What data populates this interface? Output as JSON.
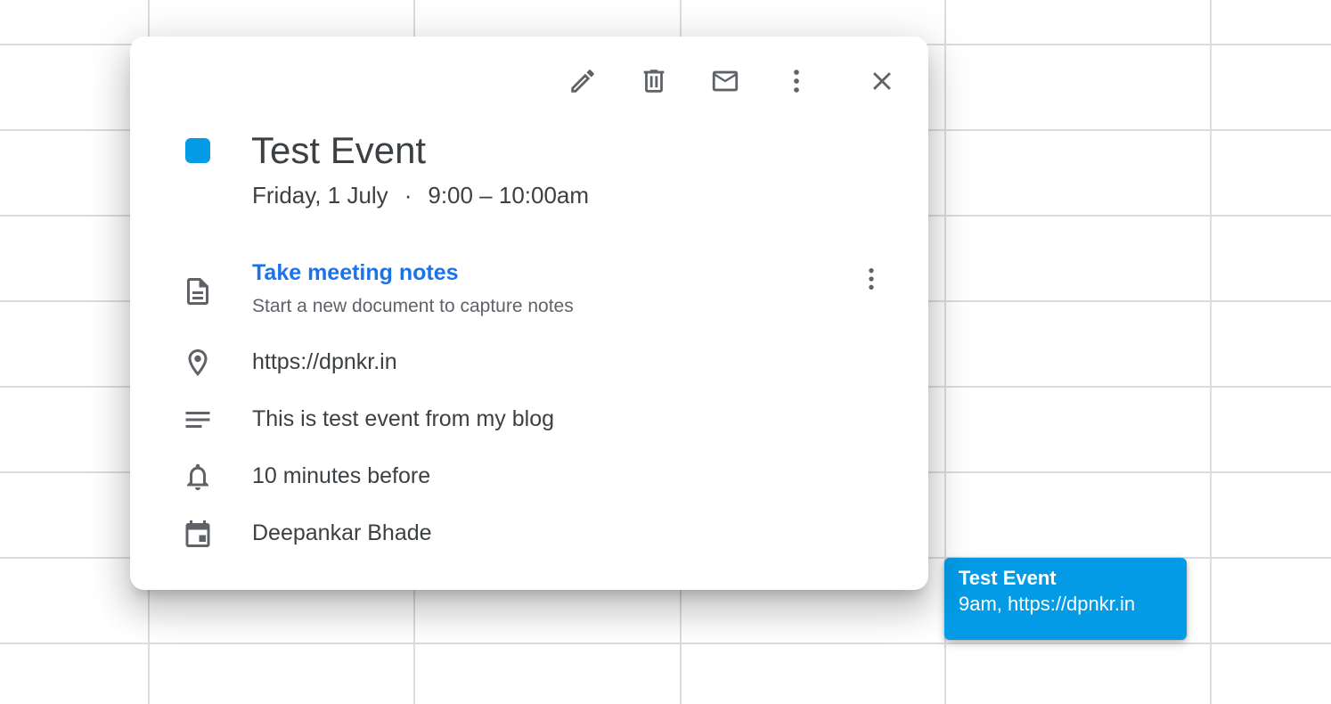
{
  "popover": {
    "toolbar": {
      "edit_icon": "pencil-icon",
      "delete_icon": "trash-icon",
      "email_icon": "mail-icon",
      "options_icon": "more-vert-icon",
      "close_icon": "close-icon"
    },
    "event_color": "#039be5",
    "title": "Test Event",
    "date": "Friday, 1 July",
    "separator": "·",
    "time": "9:00 – 10:00am",
    "notes": {
      "link": "Take meeting notes",
      "subtitle": "Start a new document to capture notes",
      "icon": "document-icon"
    },
    "location": "https://dpnkr.in",
    "description": "This is test event from my blog",
    "reminder": "10 minutes before",
    "calendar_owner": "Deepankar Bhade"
  },
  "event_chip": {
    "title": "Test Event",
    "subtitle": "9am, https://dpnkr.in",
    "color": "#039be5"
  },
  "colors": {
    "link": "#1a73e8",
    "text": "#3c4043",
    "icon": "#5f6368",
    "grid": "#dadce0"
  }
}
